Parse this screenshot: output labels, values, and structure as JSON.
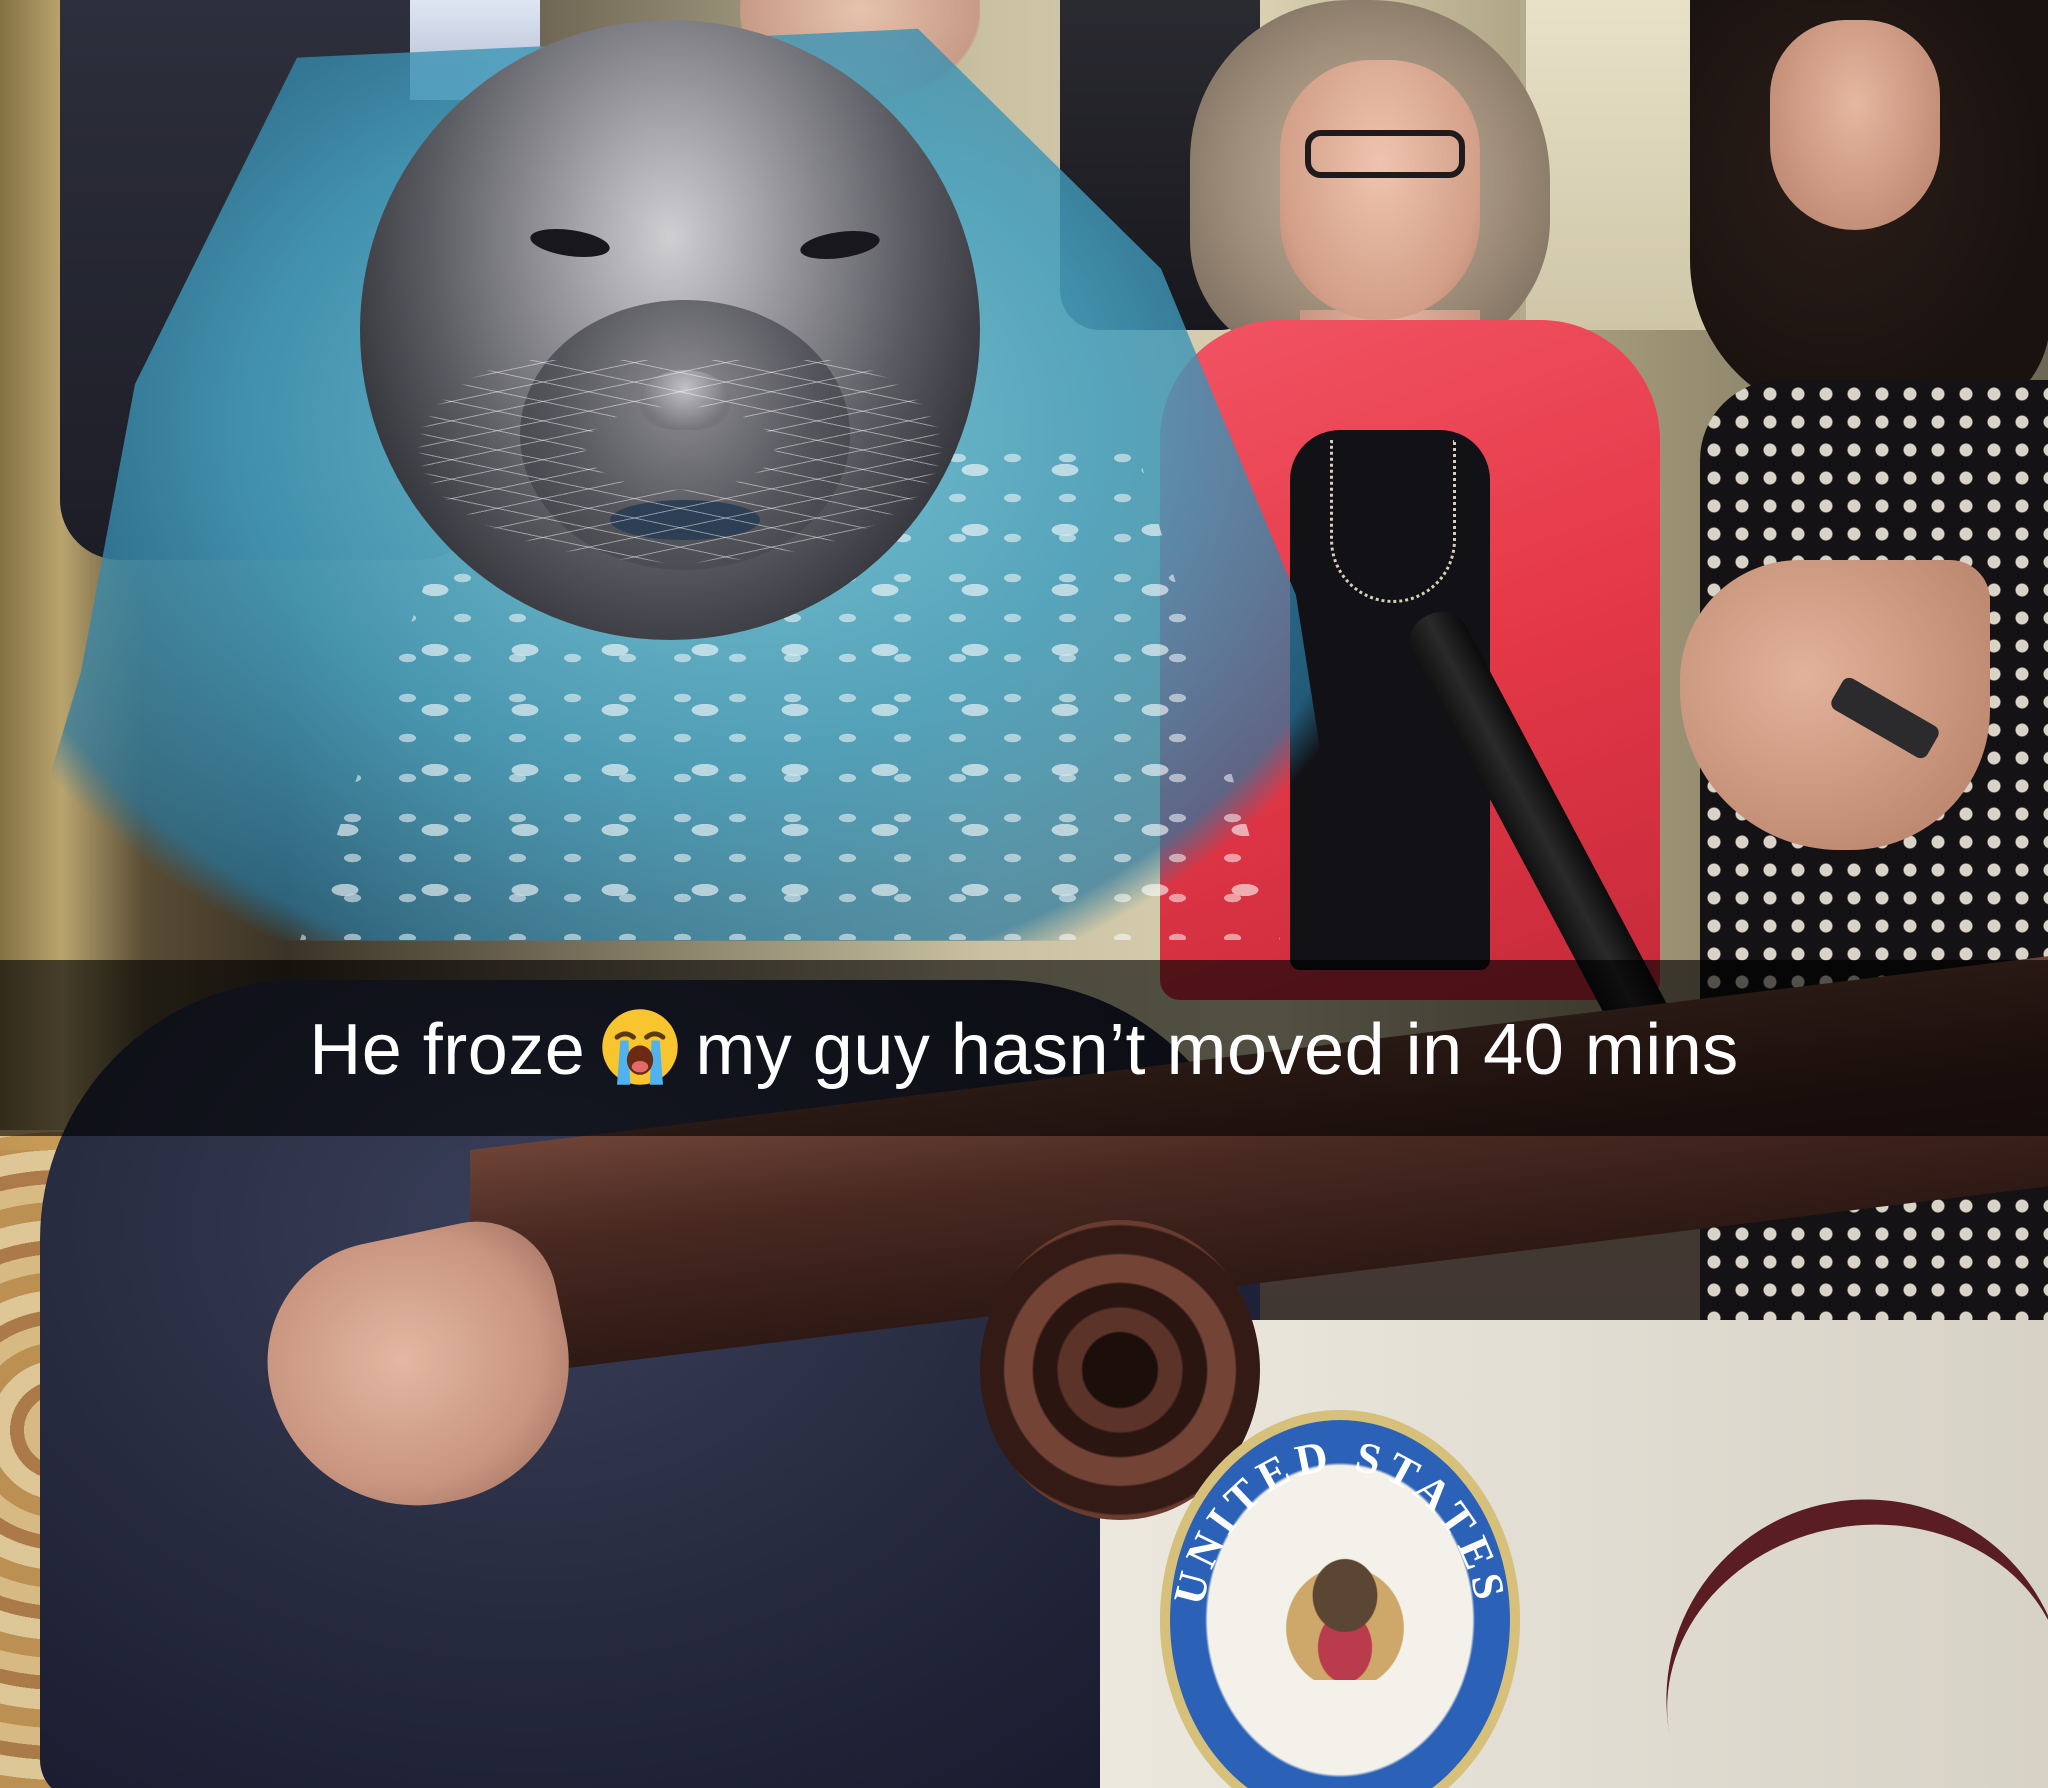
{
  "caption": {
    "text_before": "He froze",
    "emoji": "loudly-crying-face-icon",
    "text_after": "my guy hasn’t moved in 40 mins"
  },
  "podium_seal": {
    "text_top": "UNITED STATES"
  },
  "colors": {
    "caption_bar": "#000000",
    "caption_text": "#ffffff",
    "red_jacket": "#e53848",
    "seal_blue": "#2b62b8"
  }
}
